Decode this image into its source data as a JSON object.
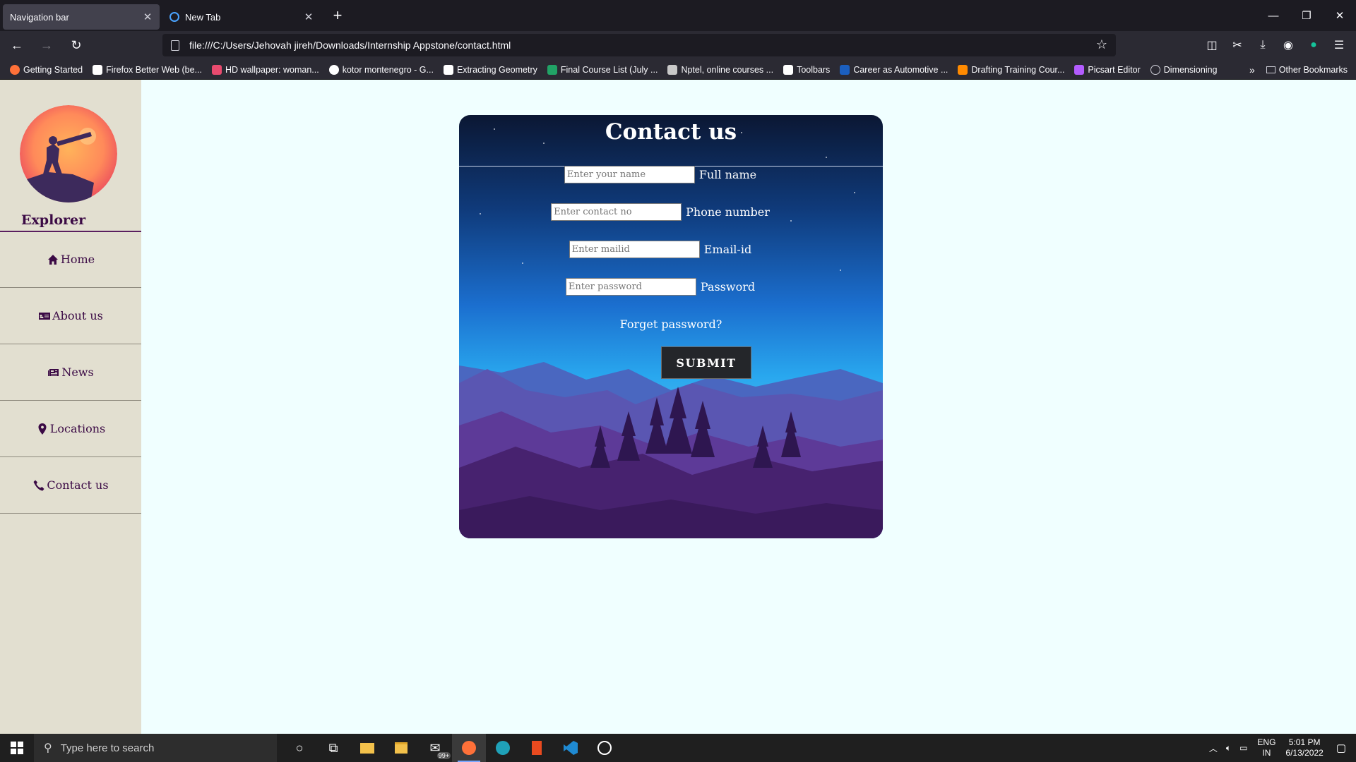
{
  "browser": {
    "tabs": [
      {
        "label": "Navigation bar",
        "active": true
      },
      {
        "label": "New Tab",
        "active": false
      }
    ],
    "url": "file:///C:/Users/Jehovah jireh/Downloads/Internship Appstone/contact.html",
    "bookmarks": [
      {
        "label": "Getting Started",
        "color": "#ff7139"
      },
      {
        "label": "Firefox Better Web (be...",
        "color": "#ffffff"
      },
      {
        "label": "HD wallpaper: woman...",
        "color": "#e94b6f"
      },
      {
        "label": "kotor montenegro - G...",
        "color": "#ffffff"
      },
      {
        "label": "Extracting Geometry",
        "color": "#ffffff"
      },
      {
        "label": "Final Course List (July ...",
        "color": "#21a366"
      },
      {
        "label": "Nptel, online courses ...",
        "color": "#c9c9c9"
      },
      {
        "label": "Toolbars",
        "color": "#ffffff"
      },
      {
        "label": "Career as Automotive ...",
        "color": "#1b5fbf"
      },
      {
        "label": "Drafting Training Cour...",
        "color": "#ff8a00"
      },
      {
        "label": "Picsart Editor",
        "color": "#b35cff"
      },
      {
        "label": "Dimensioning",
        "color": "#cfcfd8"
      }
    ],
    "other_bookmarks": "Other Bookmarks"
  },
  "sidebar": {
    "brand": "Explorer",
    "items": [
      {
        "label": "Home",
        "icon": "home-icon"
      },
      {
        "label": "About us",
        "icon": "address-card-icon"
      },
      {
        "label": "News",
        "icon": "newspaper-icon"
      },
      {
        "label": "Locations",
        "icon": "map-pin-icon"
      },
      {
        "label": "Contact us",
        "icon": "phone-icon"
      }
    ]
  },
  "form": {
    "title": "Contact us",
    "fields": [
      {
        "placeholder": "Enter your name",
        "label": "Full name"
      },
      {
        "placeholder": "Enter contact no",
        "label": "Phone number"
      },
      {
        "placeholder": "Enter mailid",
        "label": "Email-id"
      },
      {
        "placeholder": "Enter password",
        "label": "Password"
      }
    ],
    "forget": "Forget password?",
    "submit": "SUBMIT"
  },
  "taskbar": {
    "search_placeholder": "Type here to search",
    "mail_badge": "99+",
    "lang_top": "ENG",
    "lang_bottom": "IN",
    "time": "5:01 PM",
    "date": "6/13/2022"
  },
  "colors": {
    "sidebar_bg": "#e2dfd0",
    "page_bg": "#f0ffff",
    "nav_text": "#3b0a45",
    "submit_bg": "#24262a"
  }
}
